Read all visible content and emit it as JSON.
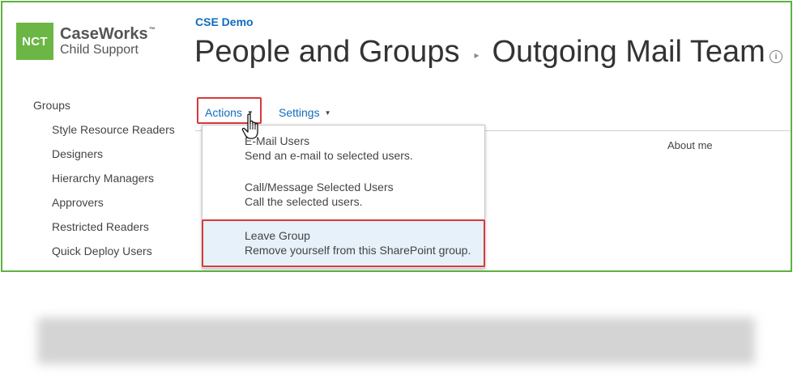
{
  "logo": {
    "badge": "NCT",
    "name": "CaseWorks",
    "trademark": "™",
    "sub": "Child Support"
  },
  "header": {
    "site_name": "CSE Demo",
    "title_part1": "People and Groups",
    "separator": "▸",
    "title_part2": "Outgoing Mail Team",
    "info_icon": "i"
  },
  "nav": {
    "heading": "Groups",
    "items": [
      {
        "label": "Style Resource Readers"
      },
      {
        "label": "Designers"
      },
      {
        "label": "Hierarchy Managers"
      },
      {
        "label": "Approvers"
      },
      {
        "label": "Restricted Readers"
      },
      {
        "label": "Quick Deploy Users"
      }
    ]
  },
  "toolbar": {
    "actions_label": "Actions",
    "settings_label": "Settings",
    "caret": "▼"
  },
  "table": {
    "about_me_header": "About me"
  },
  "menu": {
    "items": [
      {
        "title": "E-Mail Users",
        "desc": "Send an e-mail to selected users."
      },
      {
        "title": "Call/Message Selected Users",
        "desc": "Call the selected users."
      },
      {
        "title": "Leave Group",
        "desc": "Remove yourself from this SharePoint group."
      }
    ]
  },
  "colors": {
    "frame_border": "#5fb043",
    "logo_green": "#6bb644",
    "link_blue": "#0f6cbd",
    "highlight_red": "#d9383b",
    "hover_blue": "#e6f1fa"
  }
}
